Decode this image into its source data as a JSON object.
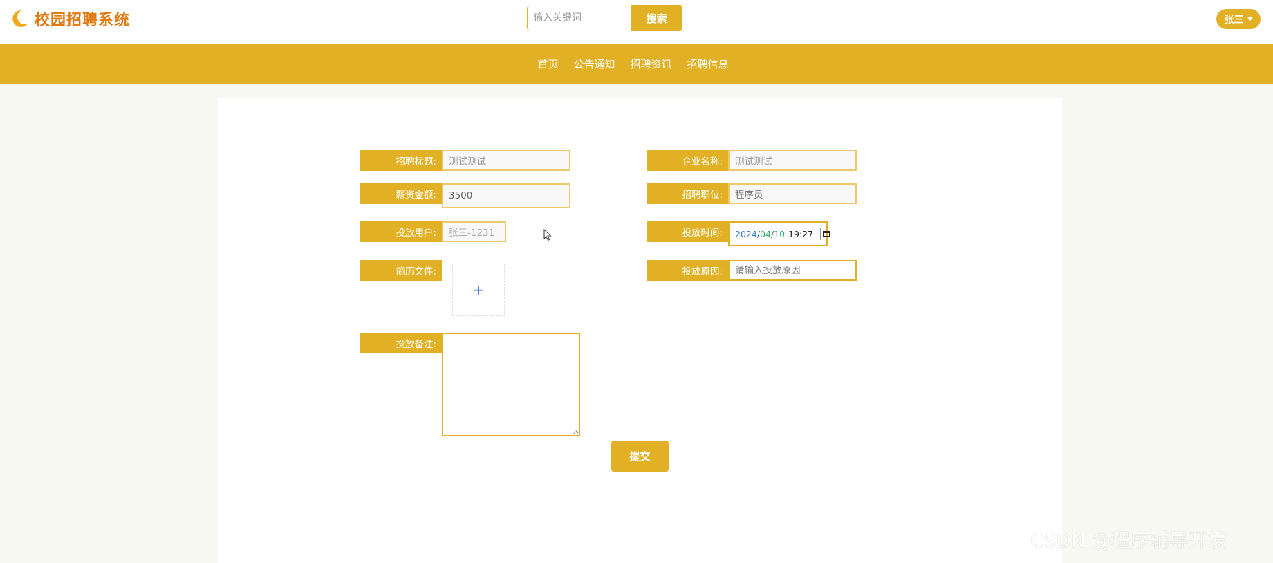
{
  "header": {
    "logo_text": "校园招聘系统",
    "search_placeholder": "输入关键词",
    "search_button": "搜索",
    "user_name": "张三"
  },
  "nav": {
    "items": [
      "首页",
      "公告通知",
      "招聘资讯",
      "招聘信息"
    ]
  },
  "form": {
    "title": {
      "label": "招聘标题:",
      "value": "测试测试"
    },
    "company": {
      "label": "企业名称:",
      "value": "测试测试"
    },
    "salary": {
      "label": "薪资金额:",
      "value": "3500"
    },
    "position": {
      "label": "招聘职位:",
      "value": "程序员"
    },
    "user": {
      "label": "投放用户:",
      "value": "张三-1231"
    },
    "time": {
      "label": "投放时间:",
      "year": "2024",
      "month": "04",
      "day": "10",
      "time": "19:27"
    },
    "resume": {
      "label": "简历文件:",
      "upload_symbol": "+"
    },
    "reason": {
      "label": "投放原因:",
      "placeholder": "请输入投放原因"
    },
    "remark": {
      "label": "投放备注:"
    },
    "submit": "提交"
  },
  "watermark": "CSDN @程序辅导开发",
  "colors": {
    "accent": "#e2b024",
    "logo": "#e07a10",
    "background": "#f7f8f1"
  }
}
